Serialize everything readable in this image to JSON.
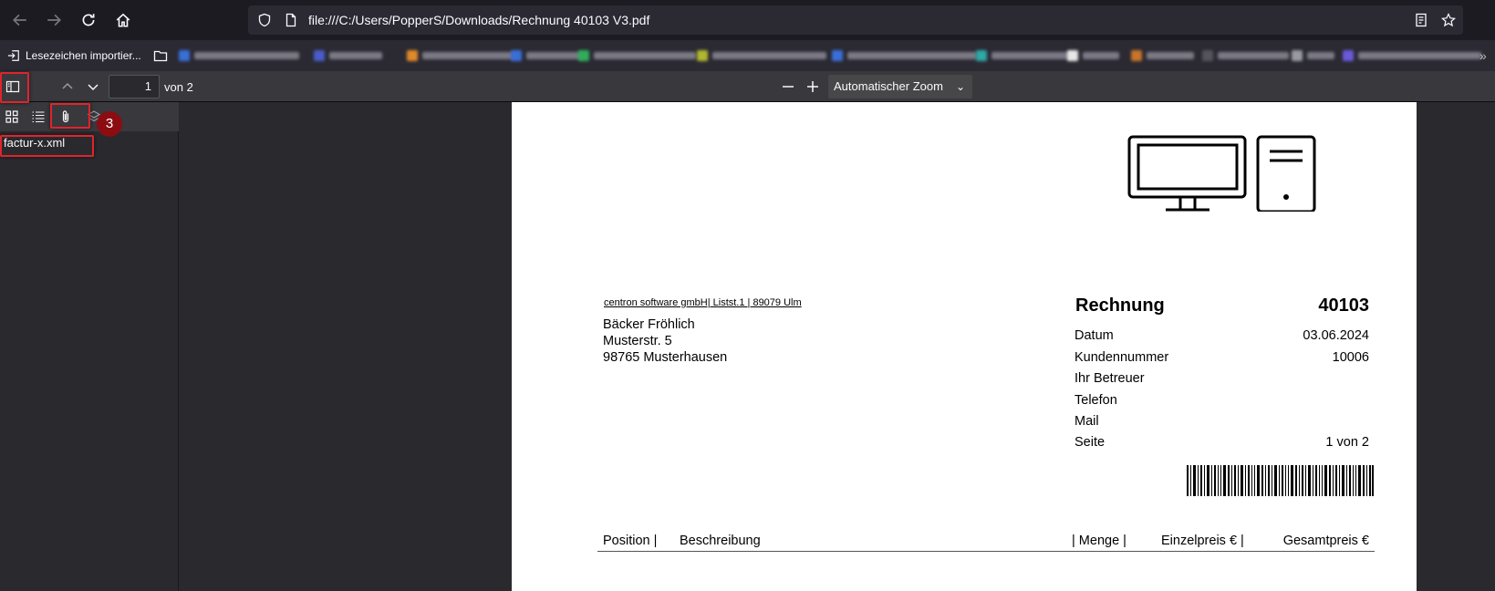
{
  "browser": {
    "url": "file:///C:/Users/PopperS/Downloads/Rechnung 40103 V3.pdf",
    "bookmarks_import_label": "Lesezeichen importier..."
  },
  "pdf_toolbar": {
    "page_number": "1",
    "page_of": "von 2",
    "zoom": "Automatischer Zoom"
  },
  "sidebar": {
    "attachments": [
      "factur-x.xml"
    ],
    "annotation_badge": "3"
  },
  "document": {
    "sender_line": "centron software gmbH| Listst.1 | 89079  Ulm",
    "recipient": [
      "Bäcker Fröhlich",
      "Musterstr. 5",
      "98765 Musterhausen"
    ],
    "title": "Rechnung",
    "invoice_number": "40103",
    "fields": [
      {
        "label": "Datum",
        "value": "03.06.2024"
      },
      {
        "label": "Kundennummer",
        "value": "10006"
      },
      {
        "label": "Ihr Betreuer",
        "value": ""
      },
      {
        "label": "Telefon",
        "value": ""
      },
      {
        "label": "Mail",
        "value": ""
      },
      {
        "label": "Seite",
        "value": "1 von 2"
      }
    ],
    "table_headers": {
      "position": "Position |",
      "description": "Beschreibung",
      "quantity": "| Menge |",
      "unit_price": "Einzelpreis € |",
      "total": "Gesamtpreis €"
    }
  },
  "colors": {
    "highlight": "#e0242c",
    "badge": "#8b0d12"
  }
}
